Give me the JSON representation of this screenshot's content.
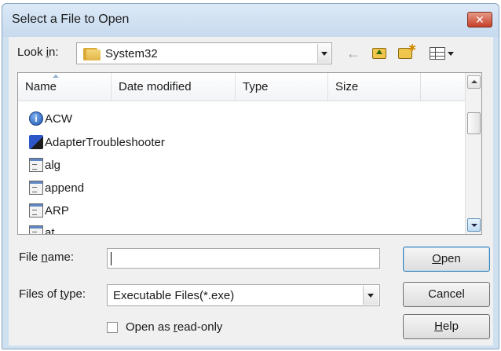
{
  "window": {
    "title": "Select a File to Open",
    "close_label": "✕"
  },
  "look_in": {
    "label_pre": "Look ",
    "label_accel": "i",
    "label_post": "n:",
    "value": "System32"
  },
  "toolbar": {
    "back_icon": "←",
    "up_icon": "up-folder-icon",
    "new_folder_icon": "new-folder-icon",
    "view_icon": "view-menu-icon"
  },
  "file_list": {
    "columns": [
      "Name",
      "Date modified",
      "Type",
      "Size"
    ],
    "items": [
      {
        "name": "ACW",
        "icon": "info-icon"
      },
      {
        "name": "AdapterTroubleshooter",
        "icon": "troubleshooter-icon"
      },
      {
        "name": "alg",
        "icon": "app-icon"
      },
      {
        "name": "append",
        "icon": "app-icon"
      },
      {
        "name": "ARP",
        "icon": "app-icon"
      },
      {
        "name": "at",
        "icon": "app-icon"
      }
    ]
  },
  "file_name": {
    "label_pre": "File ",
    "label_accel": "n",
    "label_post": "ame:",
    "value": ""
  },
  "file_type": {
    "label_pre": "Files of ",
    "label_accel": "t",
    "label_post": "ype:",
    "value": "Executable Files(*.exe)"
  },
  "read_only": {
    "label_pre": "Open as ",
    "label_accel": "r",
    "label_post": "ead-only",
    "checked": false
  },
  "buttons": {
    "open_accel": "O",
    "open_rest": "pen",
    "cancel": "Cancel",
    "help_accel": "H",
    "help_rest": "elp"
  }
}
